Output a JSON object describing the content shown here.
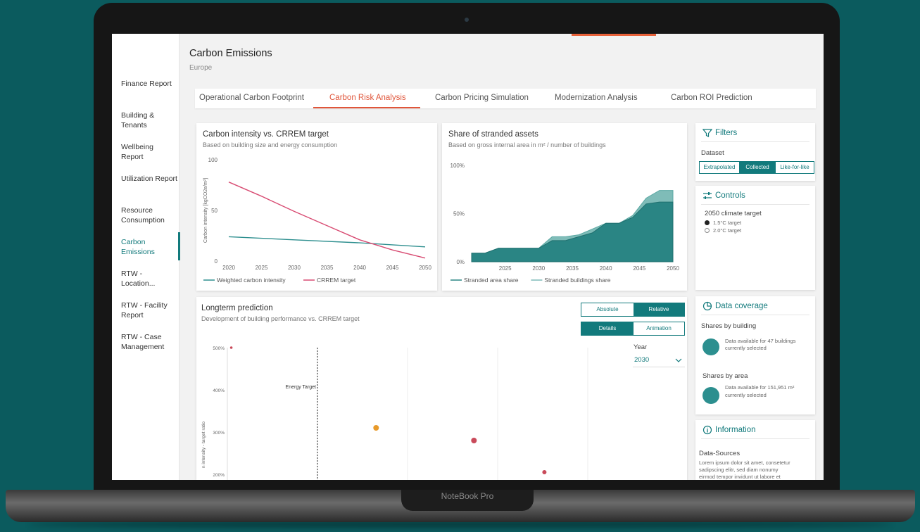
{
  "device": {
    "label": "NoteBook Pro"
  },
  "sidebar": {
    "items": [
      {
        "label": "Finance Report"
      },
      {
        "label": "Building & Tenants"
      },
      {
        "label": "Wellbeing Report"
      },
      {
        "label": "Utilization Report"
      },
      {
        "label": "Resource Consumption"
      },
      {
        "label": "Carbon Emissions"
      },
      {
        "label": "RTW - Location..."
      },
      {
        "label": "RTW - Facility Report"
      },
      {
        "label": "RTW - Case Management"
      }
    ],
    "active_index": 5
  },
  "header": {
    "title": "Carbon Emissions",
    "subtitle": "Europe"
  },
  "tabs": [
    {
      "label": "Operational Carbon Footprint"
    },
    {
      "label": "Carbon Risk Analysis"
    },
    {
      "label": "Carbon Pricing Simulation"
    },
    {
      "label": "Modernization Analysis"
    },
    {
      "label": "Carbon ROI Prediction"
    }
  ],
  "active_tab": 1,
  "colors": {
    "accent": "#e0553a",
    "teal": "#127a7c",
    "crrem": "#d84b72",
    "weighted": "#2e8f8f"
  },
  "chart_data": [
    {
      "type": "line",
      "title": "Carbon intensity vs. CRREM target",
      "subtitle": "Based on building size and energy consumption",
      "ylabel": "Carbon intensity [kgCO2e/m²]",
      "xlabel": "",
      "xlim": [
        2020,
        2050
      ],
      "ylim": [
        0,
        100
      ],
      "yticks": [
        "100",
        "50",
        "0"
      ],
      "xticks": [
        "2020",
        "2025",
        "2030",
        "2035",
        "2040",
        "2045",
        "2050"
      ],
      "legend_position": "bottom",
      "series": [
        {
          "name": "Weighted carbon intensity",
          "color": "#2e8f8f",
          "x": [
            2020,
            2030,
            2040,
            2050
          ],
          "y": [
            24,
            21,
            18,
            14
          ]
        },
        {
          "name": "CRREM target",
          "color": "#d84b72",
          "x": [
            2020,
            2025,
            2030,
            2035,
            2040,
            2045,
            2050
          ],
          "y": [
            78,
            64,
            49,
            35,
            21,
            11,
            3
          ]
        }
      ]
    },
    {
      "type": "area",
      "title": "Share of stranded assets",
      "subtitle": "Based on gross internal area in m² / number of buildings",
      "xlabel": "",
      "ylabel": "",
      "xlim": [
        2020,
        2050
      ],
      "ylim": [
        0,
        100
      ],
      "yticks": [
        "100%",
        "50%",
        "0%"
      ],
      "xticks": [
        "2025",
        "2030",
        "2035",
        "2040",
        "2045",
        "2050"
      ],
      "legend_position": "bottom",
      "series": [
        {
          "name": "Stranded area share",
          "color": "#2a8584",
          "x": [
            2020,
            2022,
            2024,
            2026,
            2028,
            2030,
            2032,
            2034,
            2036,
            2038,
            2040,
            2042,
            2044,
            2046,
            2048,
            2050
          ],
          "y": [
            9,
            9,
            14,
            14,
            14,
            14,
            22,
            22,
            26,
            30,
            40,
            40,
            46,
            60,
            62,
            62
          ]
        },
        {
          "name": "Stranded buildings share",
          "color": "#7fbcb8",
          "x": [
            2020,
            2022,
            2024,
            2026,
            2028,
            2030,
            2032,
            2034,
            2036,
            2038,
            2040,
            2042,
            2044,
            2046,
            2048,
            2050
          ],
          "y": [
            9,
            9,
            14,
            14,
            14,
            14,
            26,
            26,
            28,
            34,
            40,
            40,
            48,
            66,
            74,
            74
          ]
        }
      ]
    },
    {
      "type": "scatter",
      "title": "Longterm prediction",
      "subtitle": "Development of building performance vs. CRREM target",
      "ylabel": "Carbon intensity - target ratio",
      "xlabel": "",
      "yticks": [
        "500%",
        "400%",
        "300%",
        "200%"
      ],
      "annotation": "Energy Target",
      "series": [
        {
          "name": "",
          "color": "#e89a2a",
          "points": [
            [
              0.38,
              310
            ]
          ]
        },
        {
          "name": "",
          "color": "#c94a5a",
          "points": [
            [
              0.01,
              500
            ],
            [
              0.63,
              280
            ],
            [
              0.81,
              205
            ]
          ]
        }
      ]
    }
  ],
  "prediction": {
    "toggle1": [
      "Absolute",
      "Relative"
    ],
    "toggle1_active": 1,
    "toggle2": [
      "Details",
      "Animation"
    ],
    "toggle2_active": 0,
    "year_label": "Year",
    "year_value": "2030",
    "energy_target_label": "Energy Target",
    "ylabel_visible": "n intensity - target ratio"
  },
  "filters": {
    "title": "Filters",
    "dataset_label": "Dataset",
    "options": [
      "Extrapolated",
      "Collected",
      "Like-for-like"
    ],
    "active": 1
  },
  "controls": {
    "title": "Controls",
    "target_label": "2050 climate target",
    "options": [
      "1.5°C target",
      "2.0°C target"
    ],
    "selected": 0
  },
  "coverage": {
    "title": "Data coverage",
    "by_building_label": "Shares by building",
    "by_building_line1": "Data available for 47 buildings",
    "by_building_line2": "currently selected",
    "by_area_label": "Shares by area",
    "by_area_line1": "Data available for 151,951 m²",
    "by_area_line2": "currently selected"
  },
  "information": {
    "title": "Information",
    "sources_label": "Data-Sources",
    "body1": "Lorem ipsum dolor sit amet, consetetur",
    "body2": "sadipscing elitr, sed diam nonumy",
    "body3": "eirmod tempor invidunt ut labore et"
  }
}
